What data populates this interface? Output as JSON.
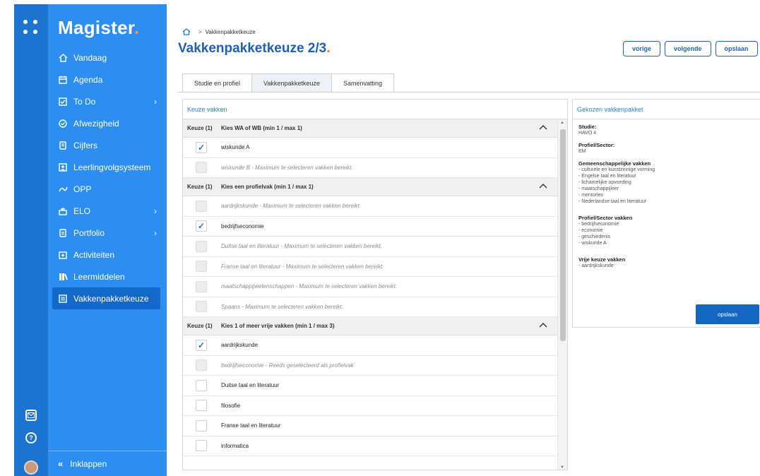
{
  "app": {
    "brand": "Magister",
    "brand_dot": "."
  },
  "rail": {
    "mail_icon": "mail-icon",
    "help_icon": "help-icon"
  },
  "sidebar": {
    "items": [
      {
        "label": "Vandaag",
        "icon": "home-icon"
      },
      {
        "label": "Agenda",
        "icon": "calendar-icon"
      },
      {
        "label": "To Do",
        "icon": "checkbox-icon",
        "chevron": "›"
      },
      {
        "label": "Afwezigheid",
        "icon": "check-circle-icon"
      },
      {
        "label": "Cijfers",
        "icon": "grades-icon"
      },
      {
        "label": "Leerlingvolgsysteem",
        "icon": "student-icon"
      },
      {
        "label": "OPP",
        "icon": "opp-icon"
      },
      {
        "label": "ELO",
        "icon": "elo-icon",
        "chevron": "›"
      },
      {
        "label": "Portfolio",
        "icon": "portfolio-icon",
        "chevron": "›"
      },
      {
        "label": "Activiteiten",
        "icon": "activity-icon"
      },
      {
        "label": "Leermiddelen",
        "icon": "books-icon"
      },
      {
        "label": "Vakkenpakketkeuze",
        "icon": "list-icon"
      }
    ],
    "collapse": {
      "symbol": "«",
      "label": "Inklappen"
    }
  },
  "breadcrumb": {
    "sep": ">",
    "current": "Vakkenpakketkeuze"
  },
  "page": {
    "title": "Vakkenpakketkeuze 2/3",
    "title_dot": "."
  },
  "actions": {
    "prev": "vorige",
    "next": "volgende",
    "save": "opslaan"
  },
  "tabs": [
    "Studie en profiel",
    "Vakkenpakketkeuze",
    "Samenvatting"
  ],
  "left_panel": {
    "title": "Keuze vakken",
    "groups": [
      {
        "keuze": "Keuze (1)",
        "title": "Kies WA of WB (min 1 / max 1)",
        "rows": [
          {
            "label": "wiskunde A",
            "checked": "✓",
            "disabled": false
          },
          {
            "label": "wiskunde B - Maximum te selecteren vakken bereikt.",
            "checked": "",
            "disabled": true
          }
        ]
      },
      {
        "keuze": "Keuze (1)",
        "title": "Kies een profielvak (min 1 / max 1)",
        "rows": [
          {
            "label": "aardrijkskunde - Maximum te selecteren vakken bereikt.",
            "checked": "",
            "disabled": true
          },
          {
            "label": "bedrijfseconomie",
            "checked": "✓",
            "disabled": false
          },
          {
            "label": "Duitse taal en literatuur - Maximum te selecteren vakken bereikt.",
            "checked": "",
            "disabled": true
          },
          {
            "label": "Franse taal en literatuur - Maximum te selecteren vakken bereikt.",
            "checked": "",
            "disabled": true
          },
          {
            "label": "maatschappijwetenschappen - Maximum te selecteren vakken bereikt.",
            "checked": "",
            "disabled": true
          },
          {
            "label": "Spaans - Maximum te selecteren vakken bereikt.",
            "checked": "",
            "disabled": true
          }
        ]
      },
      {
        "keuze": "Keuze (1)",
        "title": "Kies 1 of meer vrije vakken (min 1 / max 3)",
        "rows": [
          {
            "label": "aardrijkskunde",
            "checked": "✓",
            "disabled": false
          },
          {
            "label": "bedrijfseconomie - Reeds geselecteerd als profielvak",
            "checked": "",
            "disabled": true
          },
          {
            "label": "Duitse taal en literatuur",
            "checked": "",
            "disabled": false
          },
          {
            "label": "filosofie",
            "checked": "",
            "disabled": false
          },
          {
            "label": "Franse taal en literatuur",
            "checked": "",
            "disabled": false
          },
          {
            "label": "informatica",
            "checked": "",
            "disabled": false
          }
        ]
      }
    ]
  },
  "right_panel": {
    "title": "Gekozen vakkenpakket",
    "studie": {
      "heading": "Studie:",
      "value": "HAVO 4"
    },
    "profiel": {
      "heading": "Profiel/Sector:",
      "value": "EM"
    },
    "gemeenschappelijk": {
      "heading": "Gemeenschappelijke vakken",
      "items": [
        "- culturele en kunstzinnige vorming",
        "- Engelse taal en literatuur",
        "- lichamelijke opvoeding",
        "- maatschappijleer",
        "- mentorles",
        "- Nederlandse taal en literatuur"
      ]
    },
    "profiel_vakken": {
      "heading": "Profiel/Sector vakken",
      "items": [
        "- bedrijfseconomie",
        "- economie",
        "- geschiedenis",
        "- wiskunde A"
      ]
    },
    "vrije_keuze": {
      "heading": "Vrije keuze vakken",
      "items": [
        "- aardrijkskunde"
      ]
    },
    "save_label": "opslaan"
  },
  "colors": {
    "sidebar": "#2c8ef0",
    "rail": "#1b74d0",
    "accent": "#ff9a1a",
    "title": "#1f5fb4",
    "save": "#1465c2"
  }
}
